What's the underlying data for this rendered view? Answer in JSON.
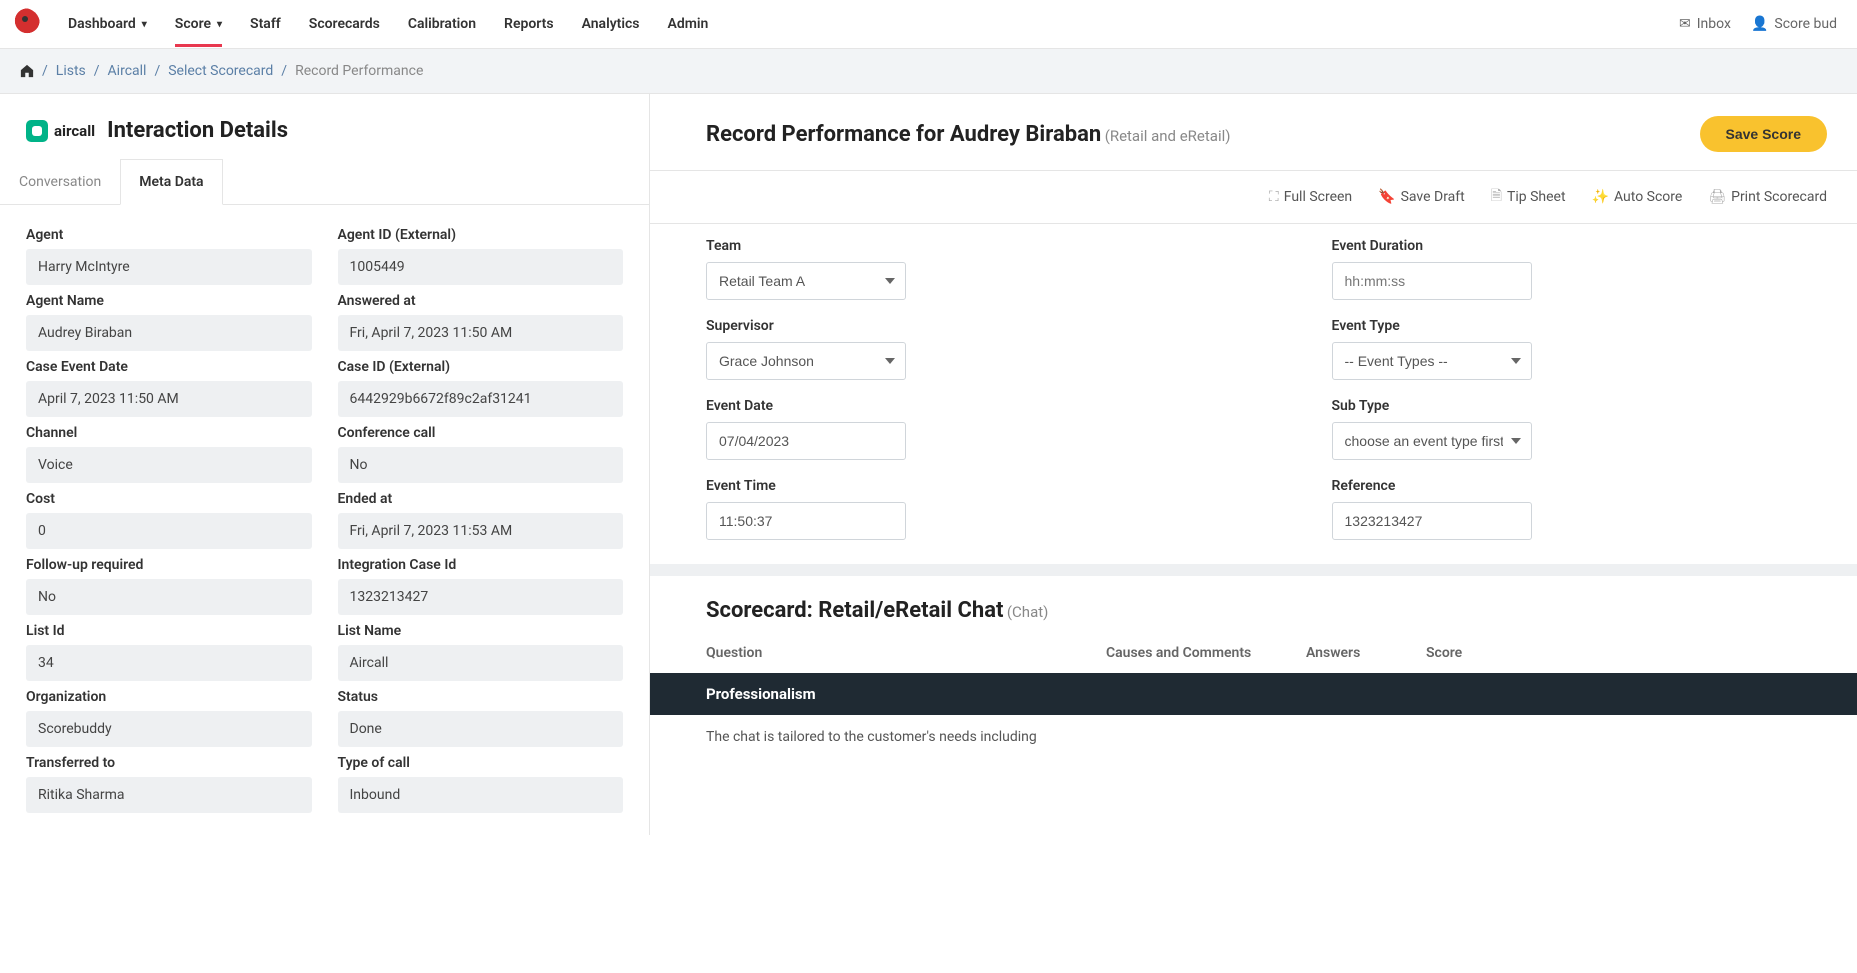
{
  "nav": {
    "items": [
      "Dashboard",
      "Score",
      "Staff",
      "Scorecards",
      "Calibration",
      "Reports",
      "Analytics",
      "Admin"
    ],
    "inbox": "Inbox",
    "user": "Score bud"
  },
  "breadcrumb": {
    "items": [
      "Lists",
      "Aircall",
      "Select Scorecard"
    ],
    "current": "Record Performance"
  },
  "left": {
    "brand": "aircall",
    "title": "Interaction Details",
    "tabs": [
      "Conversation",
      "Meta Data"
    ],
    "meta": [
      {
        "label": "Agent",
        "value": "Harry McIntyre"
      },
      {
        "label": "Agent ID (External)",
        "value": "1005449"
      },
      {
        "label": "Agent Name",
        "value": "Audrey Biraban"
      },
      {
        "label": "Answered at",
        "value": "Fri, April 7, 2023 11:50 AM"
      },
      {
        "label": "Case Event Date",
        "value": "April 7, 2023 11:50 AM"
      },
      {
        "label": "Case ID (External)",
        "value": "6442929b6672f89c2af31241"
      },
      {
        "label": "Channel",
        "value": "Voice"
      },
      {
        "label": "Conference call",
        "value": "No"
      },
      {
        "label": "Cost",
        "value": "0"
      },
      {
        "label": "Ended at",
        "value": "Fri, April 7, 2023 11:53 AM"
      },
      {
        "label": "Follow-up required",
        "value": "No"
      },
      {
        "label": "Integration Case Id",
        "value": "1323213427"
      },
      {
        "label": "List Id",
        "value": "34"
      },
      {
        "label": "List Name",
        "value": "Aircall"
      },
      {
        "label": "Organization",
        "value": "Scorebuddy"
      },
      {
        "label": "Status",
        "value": "Done"
      },
      {
        "label": "Transferred to",
        "value": "Ritika Sharma"
      },
      {
        "label": "Type of call",
        "value": "Inbound"
      }
    ]
  },
  "right": {
    "title": "Record Performance for Audrey Biraban",
    "subtitle": "(Retail and eRetail)",
    "save": "Save Score",
    "toolbar": [
      "Full Screen",
      "Save Draft",
      "Tip Sheet",
      "Auto Score",
      "Print Scorecard"
    ],
    "form": {
      "team_label": "Team",
      "team_value": "Retail Team A",
      "duration_label": "Event Duration",
      "duration_placeholder": "hh:mm:ss",
      "supervisor_label": "Supervisor",
      "supervisor_value": "Grace Johnson",
      "eventtype_label": "Event Type",
      "eventtype_value": "-- Event Types --",
      "date_label": "Event Date",
      "date_value": "07/04/2023",
      "subtype_label": "Sub Type",
      "subtype_value": "choose an event type first",
      "time_label": "Event Time",
      "time_value": "11:50:37",
      "ref_label": "Reference",
      "ref_value": "1323213427"
    },
    "scorecard": {
      "title": "Scorecard: Retail/eRetail Chat",
      "sub": "(Chat)",
      "cols": [
        "Question",
        "Causes and Comments",
        "Answers",
        "Score"
      ],
      "section": "Professionalism",
      "q1": "The chat is tailored to the customer's needs including"
    }
  }
}
